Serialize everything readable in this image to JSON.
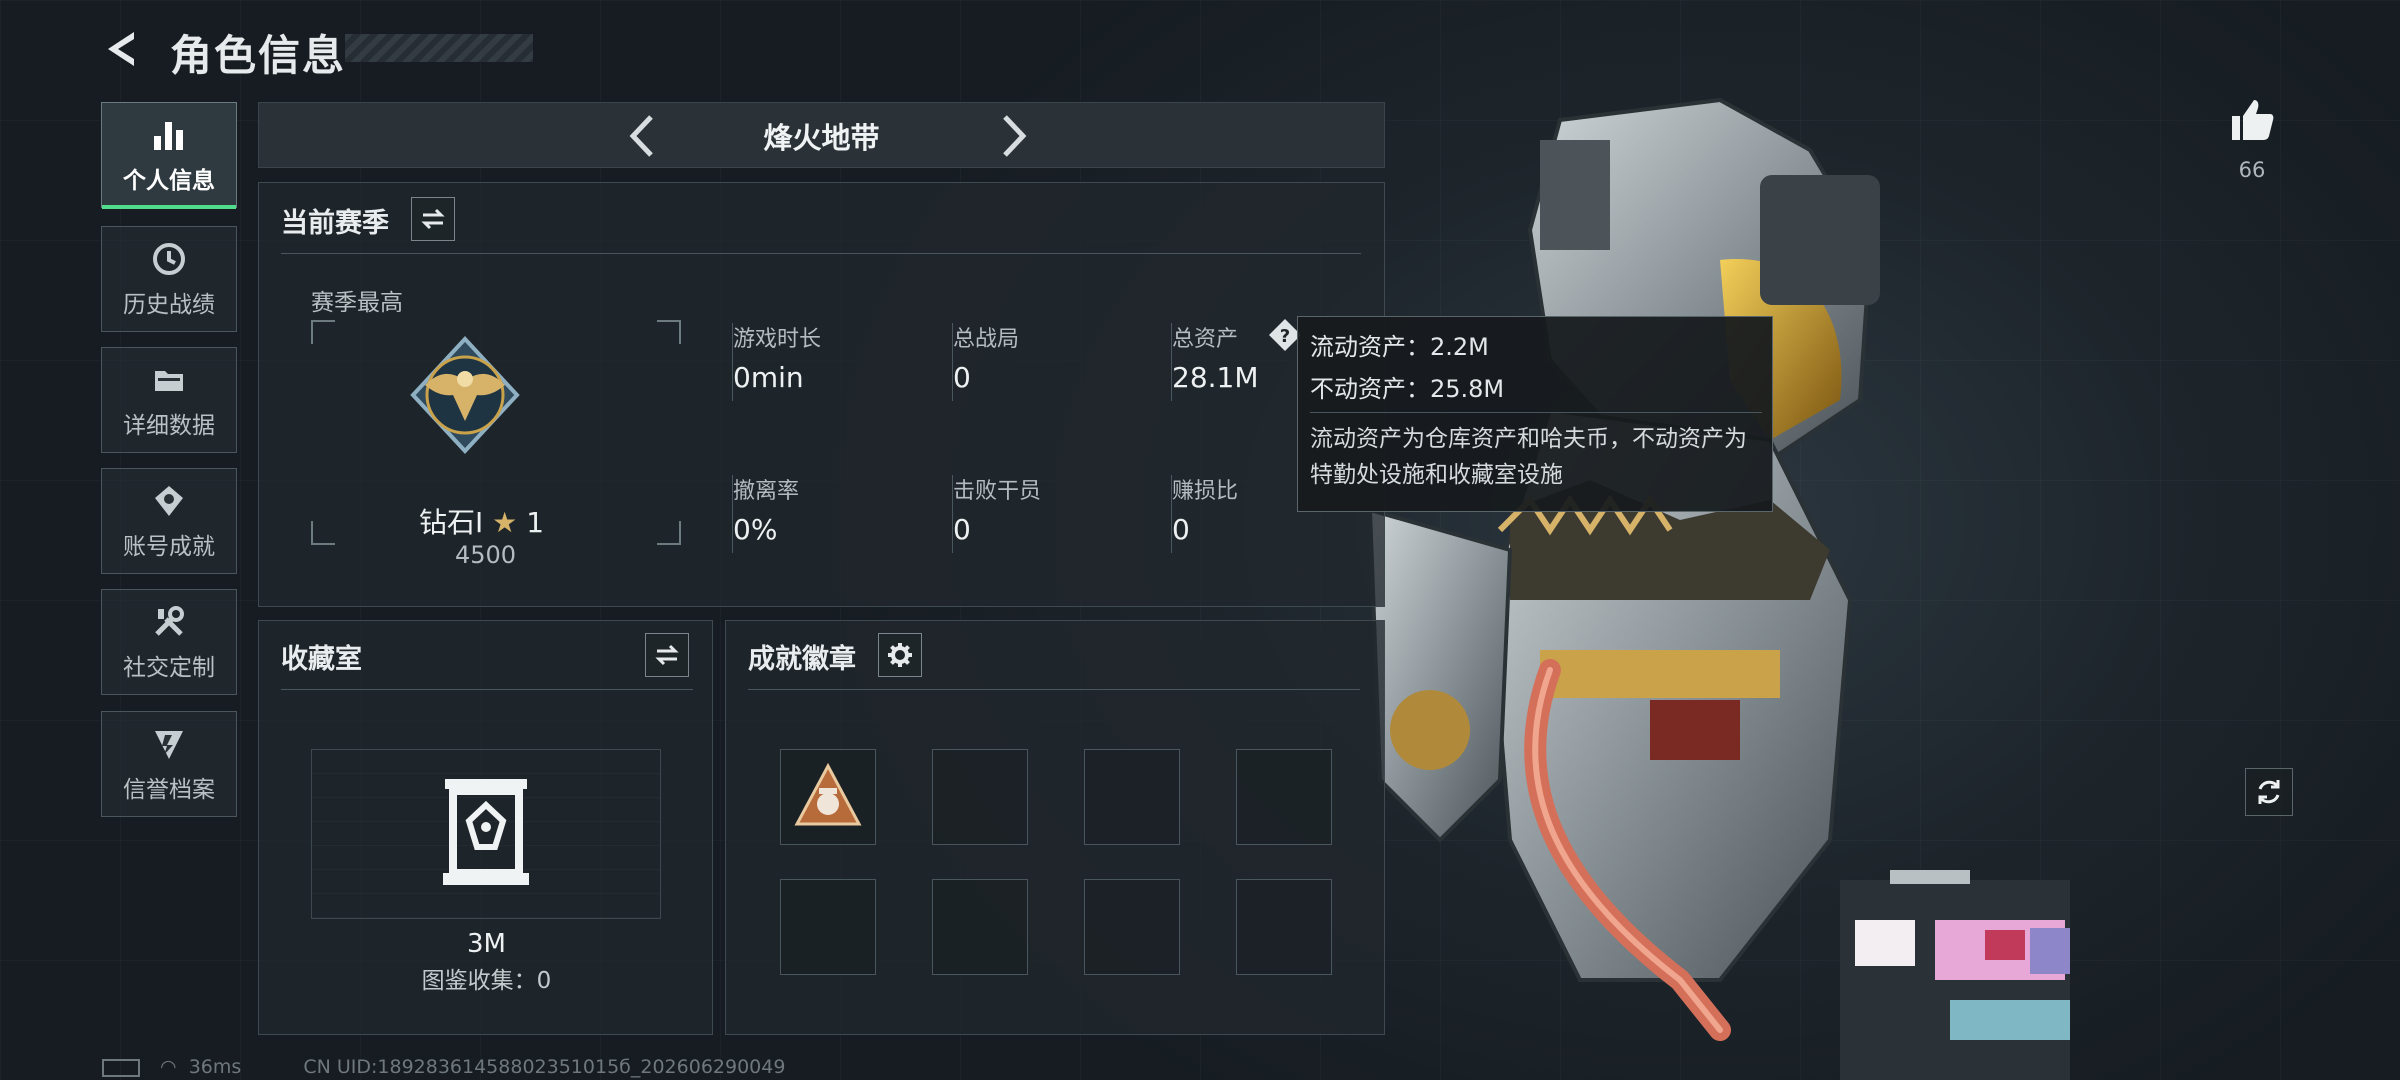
{
  "header": {
    "title": "角色信息"
  },
  "sidebar": {
    "items": [
      {
        "label": "个人信息",
        "icon": "bar-chart-icon",
        "active": true
      },
      {
        "label": "历史战绩",
        "icon": "history-clock-icon"
      },
      {
        "label": "详细数据",
        "icon": "folder-icon"
      },
      {
        "label": "账号成就",
        "icon": "achievement-icon"
      },
      {
        "label": "社交定制",
        "icon": "tools-icon"
      },
      {
        "label": "信誉档案",
        "icon": "credit-shield-icon"
      }
    ]
  },
  "mode": {
    "title": "烽火地带"
  },
  "season": {
    "title": "当前赛季",
    "best_label": "赛季最高",
    "rank_name": "钻石Ⅰ",
    "rank_stars": "1",
    "rank_score": "4500",
    "stats": [
      {
        "label": "游戏时长",
        "value": "0min"
      },
      {
        "label": "总战局",
        "value": "0"
      },
      {
        "label": "总资产",
        "value": "28.1M"
      },
      {
        "label": "撤离率",
        "value": "0%"
      },
      {
        "label": "击败干员",
        "value": "0"
      },
      {
        "label": "赚损比",
        "value": "0"
      }
    ]
  },
  "tooltip": {
    "liquid": "流动资产：2.2M",
    "fixed": "不动资产：25.8M",
    "desc": "流动资产为仓库资产和哈夫币，不动资产为特勤处设施和收藏室设施"
  },
  "collection": {
    "title": "收藏室",
    "value": "3M",
    "catalog": "图鉴收集：0"
  },
  "badges": {
    "title": "成就徽章",
    "slots": 8
  },
  "like": {
    "count": "66"
  },
  "status": {
    "ping": "36ms",
    "uid": "CN UID:18928361458802351015б_202606290049"
  },
  "colors": {
    "accent_green": "#4fdc8c",
    "gold": "#d7b36a"
  }
}
